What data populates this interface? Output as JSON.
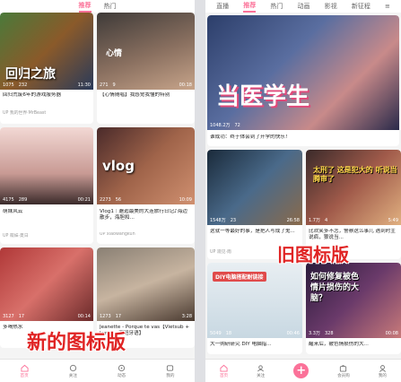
{
  "left": {
    "tabs": [
      "推荐",
      "热门"
    ],
    "cards": [
      {
        "stat1": "1075",
        "stat2": "232",
        "duration": "11:30",
        "overlay": "回归之旅",
        "title": "回归荒废6年的游戏服务器",
        "meta": "UP 我的世界·MrBeast"
      },
      {
        "stat1": "271",
        "stat2": "9",
        "duration": "00:18",
        "overlay": "心情",
        "title": "【心情随唱】我感觉我懂的特别",
        "meta": ""
      },
      {
        "stat1": "4175",
        "stat2": "289",
        "duration": "00:21",
        "overlay": "",
        "title": "萌妹风云",
        "meta": "UP 萌妹·夏日"
      },
      {
        "stat1": "2273",
        "stat2": "56",
        "duration": "10:09",
        "overlay": "vlog",
        "title": "Vlog1｜邂逅最美的大连旅行日记♪海边散步，海胆和...",
        "meta": "UP xiaowangkun"
      },
      {
        "stat1": "3127",
        "stat2": "17",
        "duration": "00:14",
        "overlay": "",
        "title": "多喝热水",
        "meta": ""
      },
      {
        "stat1": "1273",
        "stat2": "17",
        "duration": "3:28",
        "overlay": "",
        "title": "Jeanette - Porque te vas【Vietsub + Lyrics - 西班牙语】",
        "meta": ""
      }
    ],
    "banner": "新的图标版",
    "nav": [
      {
        "label": "首页",
        "icon": "home-icon"
      },
      {
        "label": "关注",
        "icon": "follow-icon"
      },
      {
        "label": "动态",
        "icon": "dynamic-icon"
      },
      {
        "label": "我的",
        "icon": "profile-icon"
      }
    ]
  },
  "right": {
    "tabs": [
      "直播",
      "推荐",
      "热门",
      "动画",
      "影视",
      "新征程"
    ],
    "top_card": {
      "overlay": "当医学生",
      "stat1": "1048.2万",
      "stat2": "72",
      "duration": "",
      "title": "谁成功：终于体会到了开学的快乐！"
    },
    "cards": [
      {
        "stat1": "1548万",
        "stat2": "23",
        "duration": "26:58",
        "overlay": "",
        "title": "这就一等最好的事，是把人写成了鬼...",
        "meta": "UP 观见·雨"
      },
      {
        "stat1": "1.7万",
        "stat2": "4",
        "duration": "5:49",
        "overlay": "太刑了 这是犯大的 听说当腾审了",
        "title": "比欢笑多不怎，警察这么事儿 遇到时主说疯，狠说当...",
        "meta": ""
      },
      {
        "stat1": "5049",
        "stat2": "18",
        "duration": "00:46",
        "overlay": "DIY电脑搭配耐链接",
        "title": "大一购研研究 DIY 电脑指...",
        "meta": ""
      },
      {
        "stat1": "3.3万",
        "stat2": "328",
        "duration": "00:08",
        "overlay": "如何修复被色情片损伤的大脑？",
        "title": "醒来后，被色情损伤的大...",
        "meta": ""
      }
    ],
    "banner": "旧图标版",
    "nav": [
      {
        "label": "首页",
        "icon": "home-icon"
      },
      {
        "label": "关注",
        "icon": "follow-icon"
      },
      {
        "label": "",
        "icon": "plus-icon"
      },
      {
        "label": "会员购",
        "icon": "shop-icon"
      },
      {
        "label": "我的",
        "icon": "profile-icon"
      }
    ]
  },
  "colors": {
    "accent": "#fb7299"
  }
}
